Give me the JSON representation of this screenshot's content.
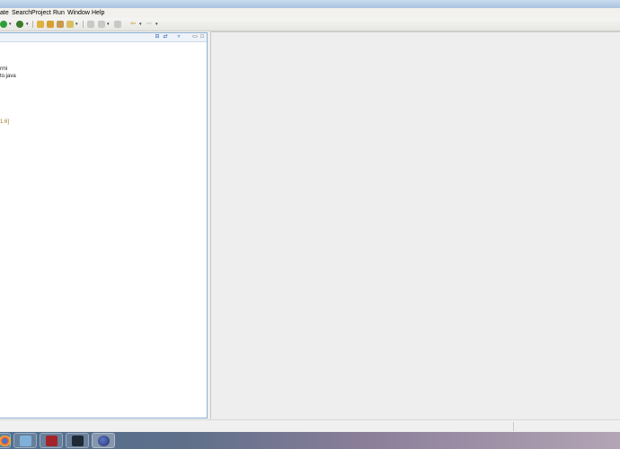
{
  "menubar": {
    "items": [
      {
        "label": "ate"
      },
      {
        "label": "Search"
      },
      {
        "label": "Project"
      },
      {
        "label": "Run"
      },
      {
        "label": "Window"
      },
      {
        "label": "Help"
      }
    ]
  },
  "package_explorer": {
    "tree": [
      {
        "label": "rmi"
      },
      {
        "label": "to.java"
      },
      {
        "label": "1.6]"
      }
    ]
  },
  "icons": {
    "toolbar": [
      "run-icon",
      "dropdown-icon",
      "bug-icon",
      "dropdown-icon",
      "open-folder-icon",
      "open-folder-icon",
      "open-type-icon",
      "wand-icon",
      "dropdown-icon",
      "annotation-icon",
      "dropdown-icon",
      "back-icon",
      "dropdown-icon",
      "forward-icon",
      "dropdown-icon"
    ],
    "panel_header": [
      "collapse-all-icon",
      "link-with-editor-icon",
      "view-menu-icon",
      "minimize-icon",
      "maximize-icon"
    ],
    "taskbar": [
      "chrome-icon",
      "explorer-icon",
      "application-icon",
      "steam-icon",
      "eclipse-icon"
    ]
  },
  "colors": {
    "accent": "#8eb0d0",
    "editor_bg": "#eeeeee",
    "version_text": "#9a7a20"
  }
}
